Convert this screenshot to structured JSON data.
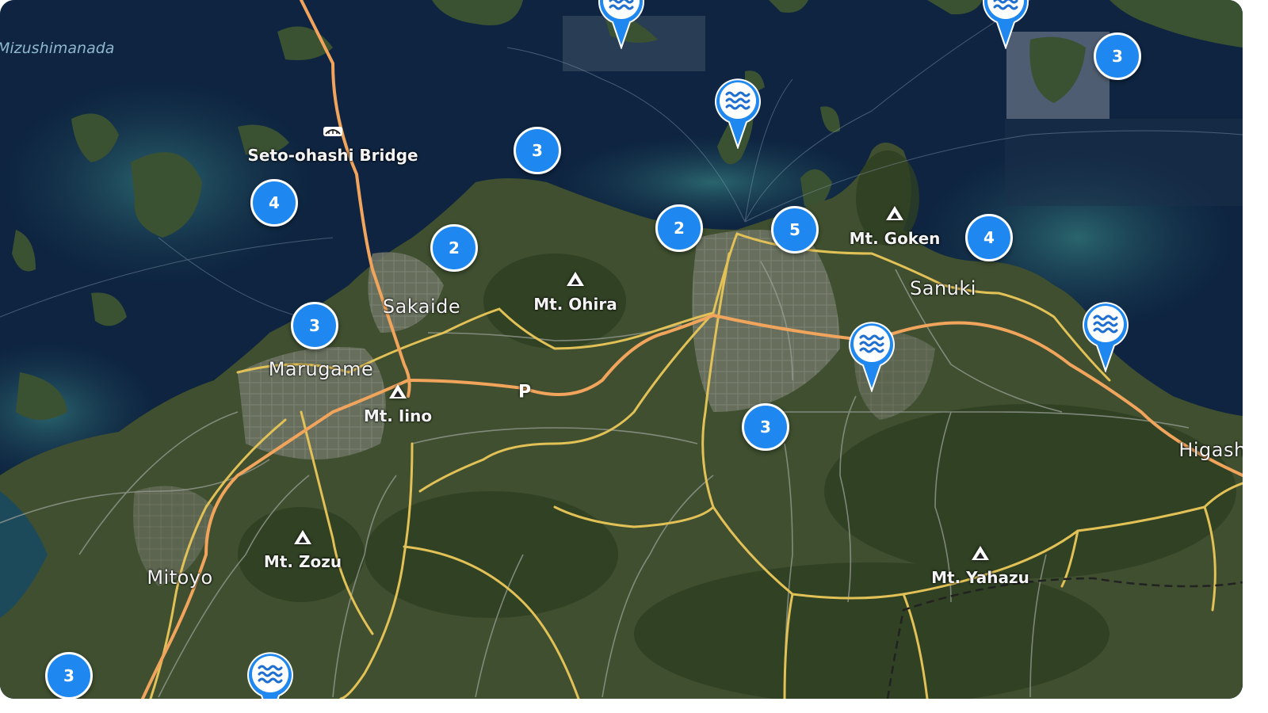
{
  "map": {
    "sea_label": "Mizushimanada",
    "place_labels": [
      {
        "id": "marugame",
        "text": "Marugame"
      },
      {
        "id": "sakaide",
        "text": "Sakaide"
      },
      {
        "id": "sanuki",
        "text": "Sanuki"
      },
      {
        "id": "mitoyo",
        "text": "Mitoyo"
      },
      {
        "id": "higashi",
        "text": "Higash"
      }
    ],
    "poi_labels": [
      {
        "id": "bridge",
        "text": "Seto-ohashi Bridge"
      },
      {
        "id": "mt-ohira",
        "text": "Mt. Ohira"
      },
      {
        "id": "mt-iino",
        "text": "Mt. Iino"
      },
      {
        "id": "mt-goken",
        "text": "Mt. Goken"
      },
      {
        "id": "mt-zozu",
        "text": "Mt. Zozu"
      },
      {
        "id": "mt-yahazu",
        "text": "Mt. Yahazu"
      }
    ],
    "parking_label": "P",
    "clusters": [
      {
        "count": "4"
      },
      {
        "count": "2"
      },
      {
        "count": "3"
      },
      {
        "count": "3"
      },
      {
        "count": "2"
      },
      {
        "count": "5"
      },
      {
        "count": "4"
      },
      {
        "count": "3"
      },
      {
        "count": "3"
      },
      {
        "count": "3"
      }
    ],
    "marker_icon": "water-waves-icon",
    "colors": {
      "cluster_fill": "#1f87f0",
      "marker_fill": "#1f87f0",
      "primary_road": "#f3a35a",
      "secondary_road": "#e8c45a",
      "sea": "#0f2540",
      "land": "#3c4d2e"
    }
  }
}
